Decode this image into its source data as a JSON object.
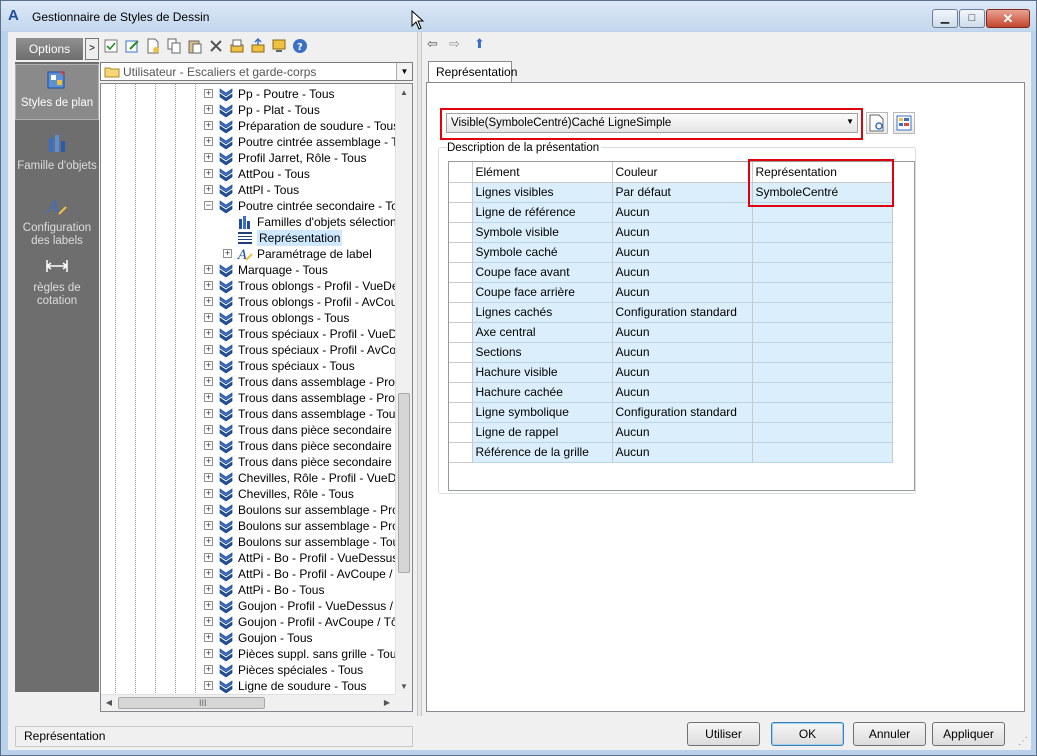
{
  "window": {
    "title": "Gestionnaire de Styles de Dessin",
    "app_icon": "A",
    "controls": {
      "minimize": "▁",
      "maximize": "□",
      "close": "✕"
    }
  },
  "sidebar": {
    "options_label": "Options",
    "options_toggle": ">",
    "items": [
      {
        "label": "Styles de plan",
        "icon": "plan-styles-icon"
      },
      {
        "label": "Famille d'objets",
        "icon": "object-family-icon"
      },
      {
        "label": "Configuration des labels",
        "icon": "label-config-icon"
      },
      {
        "label": "règles de cotation",
        "icon": "dimension-rules-icon"
      }
    ]
  },
  "left_toolbar": {
    "icons": [
      "checkmark-icon",
      "edit-icon",
      "new-icon",
      "copy-icon",
      "paste-icon",
      "delete-icon",
      "import-icon",
      "export-icon",
      "display-icon",
      "help-icon"
    ]
  },
  "location_combo": {
    "value": "Utilisateur - Escaliers et garde-corps",
    "arrow": "▼"
  },
  "tree": {
    "rows": [
      {
        "label": "Pp - Poutre - Tous",
        "expander": "+",
        "level": 0
      },
      {
        "label": "Pp - Plat - Tous",
        "expander": "+",
        "level": 0
      },
      {
        "label": "Préparation de soudure - Tous",
        "expander": "+",
        "level": 0
      },
      {
        "label": "Poutre cintrée assemblage - Tous",
        "expander": "+",
        "level": 0
      },
      {
        "label": "Profil Jarret, Rôle - Tous",
        "expander": "+",
        "level": 0
      },
      {
        "label": "AttPou - Tous",
        "expander": "+",
        "level": 0
      },
      {
        "label": "AttPl - Tous",
        "expander": "+",
        "level": 0
      },
      {
        "label": "Poutre cintrée secondaire - Tous",
        "expander": "−",
        "level": 0
      },
      {
        "label": "Familles d'objets sélectionnée",
        "expander": "",
        "level": 1,
        "icon": "family-icon"
      },
      {
        "label": "Représentation",
        "expander": "",
        "level": 1,
        "icon": "representation-icon",
        "selected": true
      },
      {
        "label": "Paramétrage de label",
        "expander": "+",
        "level": 1,
        "icon": "label-icon"
      },
      {
        "label": "Marquage - Tous",
        "expander": "+",
        "level": 0
      },
      {
        "label": "Trous oblongs - Profil - VueDessus",
        "expander": "+",
        "level": 0
      },
      {
        "label": "Trous oblongs - Profil - AvCoupe /",
        "expander": "+",
        "level": 0
      },
      {
        "label": "Trous oblongs - Tous",
        "expander": "+",
        "level": 0
      },
      {
        "label": "Trous spéciaux - Profil - VueDessu",
        "expander": "+",
        "level": 0
      },
      {
        "label": "Trous spéciaux - Profil - AvCoupe",
        "expander": "+",
        "level": 0
      },
      {
        "label": "Trous spéciaux - Tous",
        "expander": "+",
        "level": 0
      },
      {
        "label": "Trous dans assemblage - Profil - V",
        "expander": "+",
        "level": 0
      },
      {
        "label": "Trous dans assemblage - Profil - A",
        "expander": "+",
        "level": 0
      },
      {
        "label": "Trous dans assemblage - Tous",
        "expander": "+",
        "level": 0
      },
      {
        "label": "Trous dans pièce secondaire - Pro",
        "expander": "+",
        "level": 0
      },
      {
        "label": "Trous dans pièce secondaire - Pro",
        "expander": "+",
        "level": 0
      },
      {
        "label": "Trous dans pièce secondaire - To",
        "expander": "+",
        "level": 0
      },
      {
        "label": "Chevilles, Rôle - Profil - VueDessu",
        "expander": "+",
        "level": 0
      },
      {
        "label": "Chevilles, Rôle - Tous",
        "expander": "+",
        "level": 0
      },
      {
        "label": "Boulons sur assemblage - Profil - V",
        "expander": "+",
        "level": 0
      },
      {
        "label": "Boulons sur assemblage - Profil - A",
        "expander": "+",
        "level": 0
      },
      {
        "label": "Boulons sur assemblage - Tous",
        "expander": "+",
        "level": 0
      },
      {
        "label": "AttPi - Bo - Profil - VueDessus / Tô",
        "expander": "+",
        "level": 0
      },
      {
        "label": "AttPi - Bo - Profil - AvCoupe / Tôle",
        "expander": "+",
        "level": 0
      },
      {
        "label": "AttPi - Bo - Tous",
        "expander": "+",
        "level": 0
      },
      {
        "label": "Goujon - Profil - VueDessus / Tôle",
        "expander": "+",
        "level": 0
      },
      {
        "label": "Goujon - Profil - AvCoupe / Tôle -",
        "expander": "+",
        "level": 0
      },
      {
        "label": "Goujon - Tous",
        "expander": "+",
        "level": 0
      },
      {
        "label": "Pièces suppl. sans grille - Tous",
        "expander": "+",
        "level": 0
      },
      {
        "label": "Pièces spéciales - Tous",
        "expander": "+",
        "level": 0
      },
      {
        "label": "Ligne de soudure - Tous",
        "expander": "+",
        "level": 0
      }
    ],
    "scroll": {
      "up": "▲",
      "down": "▼",
      "left": "◀",
      "right": "▶",
      "grip": "III"
    }
  },
  "right_toolbar": {
    "back": "⇦",
    "forward": "⇨",
    "up": "⬆"
  },
  "tab": {
    "label": "Représentation"
  },
  "representation_select": {
    "value": "Visible(SymboleCentré)Caché LigneSimple",
    "arrow": "▼"
  },
  "description_group": {
    "title": "Description de la présentation",
    "columns": [
      "Elément",
      "Couleur",
      "Représentation"
    ],
    "rows": [
      {
        "element": "Lignes visibles",
        "couleur": "Par défaut",
        "representation": "SymboleCentré"
      },
      {
        "element": "Ligne de référence",
        "couleur": "Aucun",
        "representation": ""
      },
      {
        "element": "Symbole visible",
        "couleur": "Aucun",
        "representation": ""
      },
      {
        "element": "Symbole caché",
        "couleur": "Aucun",
        "representation": ""
      },
      {
        "element": "Coupe face avant",
        "couleur": "Aucun",
        "representation": ""
      },
      {
        "element": "Coupe face arrière",
        "couleur": "Aucun",
        "representation": ""
      },
      {
        "element": "Lignes cachés",
        "couleur": "Configuration standard",
        "representation": ""
      },
      {
        "element": "Axe central",
        "couleur": "Aucun",
        "representation": ""
      },
      {
        "element": "Sections",
        "couleur": "Aucun",
        "representation": ""
      },
      {
        "element": "Hachure visible",
        "couleur": "Aucun",
        "representation": ""
      },
      {
        "element": "Hachure cachée",
        "couleur": "Aucun",
        "representation": ""
      },
      {
        "element": "Ligne symbolique",
        "couleur": "Configuration standard",
        "representation": ""
      },
      {
        "element": "Ligne de rappel",
        "couleur": "Aucun",
        "representation": ""
      },
      {
        "element": "Référence de la grille",
        "couleur": "Aucun",
        "representation": ""
      }
    ]
  },
  "status": {
    "text": "Représentation",
    "grip": "⋰"
  },
  "buttons": {
    "use": "Utiliser",
    "ok": "OK",
    "cancel": "Annuler",
    "apply": "Appliquer"
  },
  "colors": {
    "highlight_red": "#e0000f",
    "grid_row": "#dbeefb",
    "selected_tree": "#cde8ff"
  }
}
